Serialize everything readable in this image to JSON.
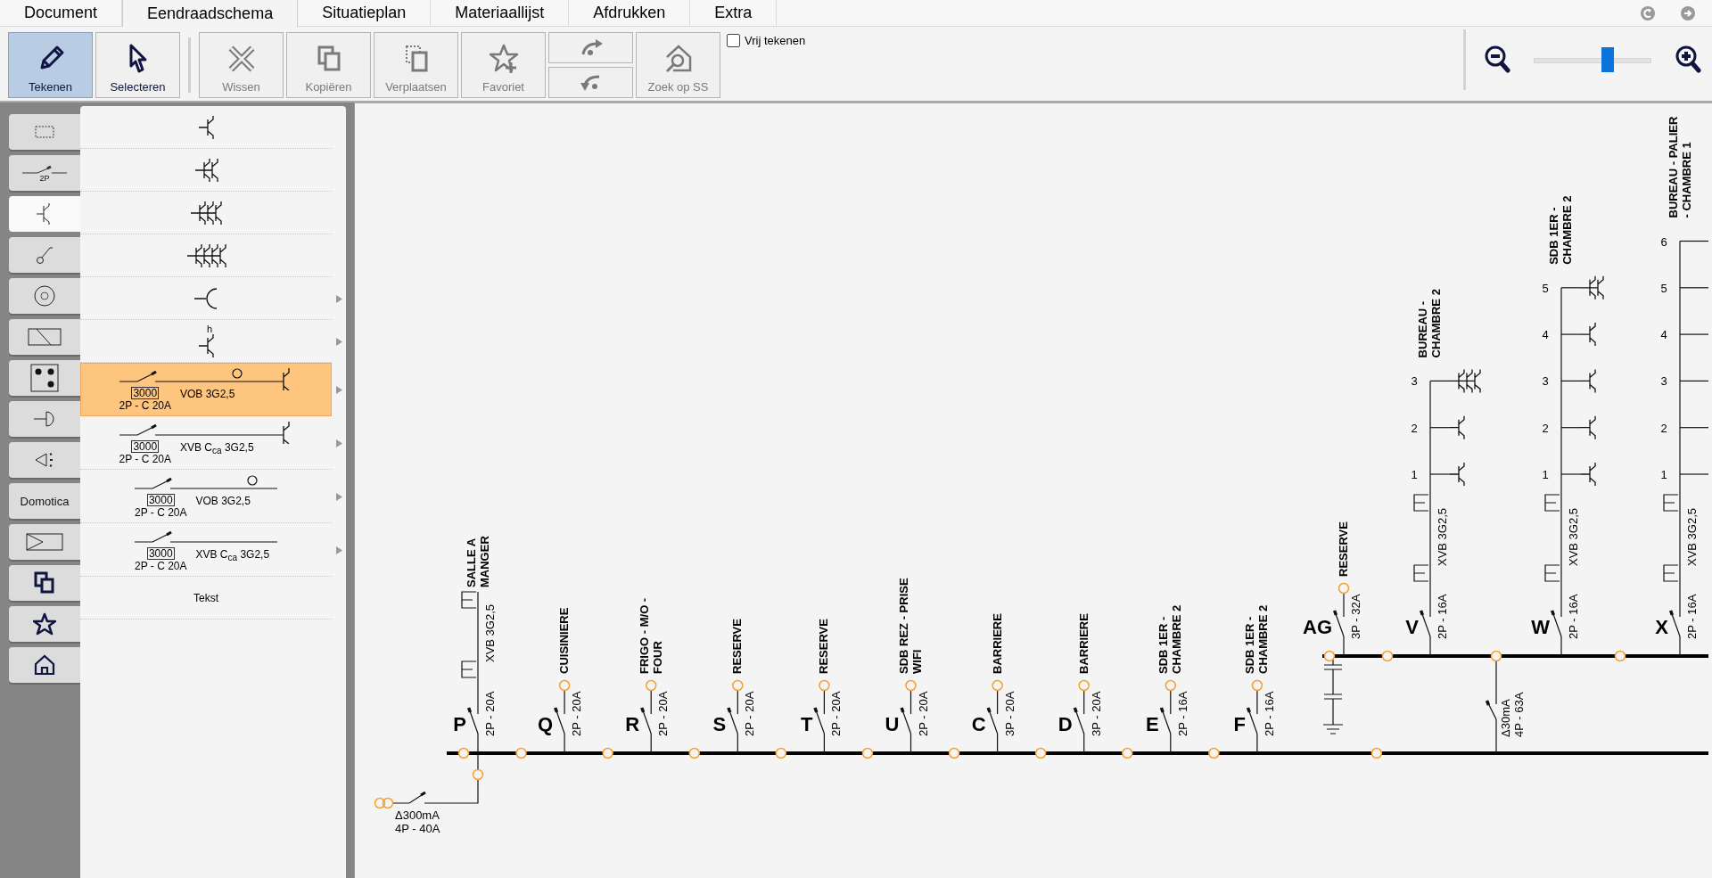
{
  "tabs": [
    {
      "label": "Document",
      "selected": false
    },
    {
      "label": "Eendraadschema",
      "selected": true
    },
    {
      "label": "Situatieplan",
      "selected": false
    },
    {
      "label": "Materiaallijst",
      "selected": false
    },
    {
      "label": "Afdrukken",
      "selected": false
    },
    {
      "label": "Extra",
      "selected": false
    }
  ],
  "toolbar": {
    "buttons": [
      {
        "kind": "pencil",
        "label": "Tekenen",
        "selected": true,
        "disabled": false
      },
      {
        "kind": "pointer",
        "label": "Selecteren",
        "selected": false,
        "disabled": false
      },
      {
        "kind": "cross",
        "label": "Wissen",
        "selected": false,
        "disabled": true
      },
      {
        "kind": "copy",
        "label": "Kopiëren",
        "selected": false,
        "disabled": true
      },
      {
        "kind": "move",
        "label": "Verplaatsen",
        "selected": false,
        "disabled": true
      },
      {
        "kind": "star",
        "label": "Favoriet",
        "selected": false,
        "disabled": true
      },
      {
        "kind": "arrow-pair",
        "selected": false,
        "disabled": true
      },
      {
        "kind": "house-search",
        "label": "Zoek op SS",
        "selected": false,
        "disabled": true
      }
    ],
    "free_draw": {
      "label": "Vrij tekenen",
      "checked": false
    },
    "zoom": {
      "level": 0.63
    }
  },
  "categories": [
    {
      "kind": "dashed-rect",
      "selected": false
    },
    {
      "kind": "breaker",
      "label": "2P",
      "selected": false
    },
    {
      "kind": "switch",
      "selected": true
    },
    {
      "kind": "lamp-switch",
      "selected": false
    },
    {
      "kind": "socket",
      "selected": false
    },
    {
      "kind": "rect-diagonal",
      "selected": false
    },
    {
      "kind": "dots",
      "selected": false
    },
    {
      "kind": "half-circle",
      "selected": false
    },
    {
      "kind": "speaker",
      "selected": false
    },
    {
      "kind": "text",
      "label": "Domotica",
      "selected": false
    },
    {
      "kind": "triangle-rect",
      "selected": false
    },
    {
      "kind": "copy",
      "selected": false
    },
    {
      "kind": "star",
      "selected": false
    },
    {
      "kind": "house",
      "selected": false
    }
  ],
  "symbols": [
    {
      "kind": "switch-1",
      "has_submenu": false,
      "selected": false
    },
    {
      "kind": "switch-2",
      "has_submenu": false,
      "selected": false
    },
    {
      "kind": "switch-3",
      "has_submenu": false,
      "selected": false
    },
    {
      "kind": "switch-4",
      "has_submenu": false,
      "selected": false
    },
    {
      "kind": "socket",
      "has_submenu": true,
      "selected": false
    },
    {
      "kind": "switch-1",
      "mark": "h",
      "has_submenu": true,
      "selected": false
    },
    {
      "kind": "circuit",
      "code": "3000",
      "rating": "2P - C 20A",
      "cable": "VOB 3G2,5",
      "outlet": true,
      "end_switch": true,
      "has_submenu": true,
      "selected": true
    },
    {
      "kind": "circuit",
      "code": "3000",
      "rating": "2P - C 20A",
      "cable": "XVB C$_{ca}$ 3G2,5",
      "outlet": false,
      "end_switch": true,
      "has_submenu": true,
      "selected": false
    },
    {
      "kind": "circuit",
      "code": "3000",
      "rating": "2P - C 20A",
      "cable": "VOB 3G2,5",
      "outlet": true,
      "end_switch": false,
      "has_submenu": true,
      "selected": false
    },
    {
      "kind": "circuit",
      "code": "3000",
      "rating": "2P - C 20A",
      "cable": "XVB C$_{ca}$ 3G2,5",
      "outlet": false,
      "end_switch": false,
      "has_submenu": true,
      "selected": false
    },
    {
      "kind": "text",
      "label": "Tekst",
      "has_submenu": false,
      "selected": false
    }
  ],
  "schematic": {
    "main_breaker": {
      "sensitivity": "Δ300mA",
      "rating": "4P - 40A"
    },
    "lower_circuits": [
      {
        "kind": "cable",
        "letter": "P",
        "rating": "2P - 20A",
        "cable": "XVB 3G2,5",
        "label": [
          "SALLE A",
          "MANGER"
        ]
      },
      {
        "kind": "endpoint",
        "letter": "Q",
        "rating": "2P - 20A",
        "label": [
          "CUISINIERE"
        ]
      },
      {
        "kind": "endpoint",
        "letter": "R",
        "rating": "2P - 20A",
        "label": [
          "FRIGO - M/O -",
          "FOUR"
        ]
      },
      {
        "kind": "endpoint",
        "letter": "S",
        "rating": "2P - 20A",
        "label": [
          "RESERVE"
        ]
      },
      {
        "kind": "endpoint",
        "letter": "T",
        "rating": "2P - 20A",
        "label": [
          "RESERVE"
        ]
      },
      {
        "kind": "endpoint",
        "letter": "U",
        "rating": "2P - 20A",
        "label": [
          "SDB REZ - PRISE",
          "WIFI"
        ]
      },
      {
        "kind": "endpoint",
        "letter": "C",
        "rating": "3P - 20A",
        "label": [
          "BARRIERE"
        ]
      },
      {
        "kind": "endpoint",
        "letter": "D",
        "rating": "3P - 20A",
        "label": [
          "BARRIERE"
        ]
      },
      {
        "kind": "endpoint",
        "letter": "E",
        "rating": "2P - 16A",
        "label": [
          "SDB 1ER -",
          "CHAMBRE 2"
        ]
      },
      {
        "kind": "endpoint",
        "letter": "F",
        "rating": "2P - 16A",
        "label": [
          "SDB 1ER -",
          "CHAMBRE 2"
        ]
      }
    ],
    "differential": {
      "sensitivity": "Δ30mA",
      "rating": "4P - 63A"
    },
    "upper_circuits": [
      {
        "kind": "endpoint",
        "letter": "AG",
        "rating": "3P - 32A",
        "label": [
          "RESERVE"
        ]
      },
      {
        "kind": "lighting",
        "letter": "V",
        "rating": "2P - 16A",
        "cable": "XVB 3G2,5",
        "label": [
          "BUREAU -",
          "CHAMBRE 2"
        ],
        "points": [
          {
            "number": "3",
            "kind": "switch-3"
          },
          {
            "number": "2",
            "kind": "switch-1"
          },
          {
            "number": "1",
            "kind": "switch-1"
          }
        ]
      },
      {
        "kind": "lighting",
        "letter": "W",
        "rating": "2P - 16A",
        "cable": "XVB 3G2,5",
        "label": [
          "SDB 1ER -",
          "CHAMBRE 2"
        ],
        "points": [
          {
            "number": "5",
            "kind": "switch-2"
          },
          {
            "number": "4",
            "kind": "switch-1"
          },
          {
            "number": "3",
            "kind": "switch-1"
          },
          {
            "number": "2",
            "kind": "switch-1"
          },
          {
            "number": "1",
            "kind": "switch-1"
          }
        ]
      },
      {
        "kind": "lighting",
        "letter": "X",
        "rating": "2P - 16A",
        "cable": "XVB 3G2,5",
        "label": [
          "BUREAU - PALIER",
          "- CHAMBRE 1"
        ],
        "points": [
          {
            "number": "6",
            "kind": "none"
          },
          {
            "number": "5",
            "kind": "none"
          },
          {
            "number": "4",
            "kind": "none"
          },
          {
            "number": "3",
            "kind": "none"
          },
          {
            "number": "2",
            "kind": "none"
          },
          {
            "number": "1",
            "kind": "none"
          }
        ]
      }
    ]
  }
}
